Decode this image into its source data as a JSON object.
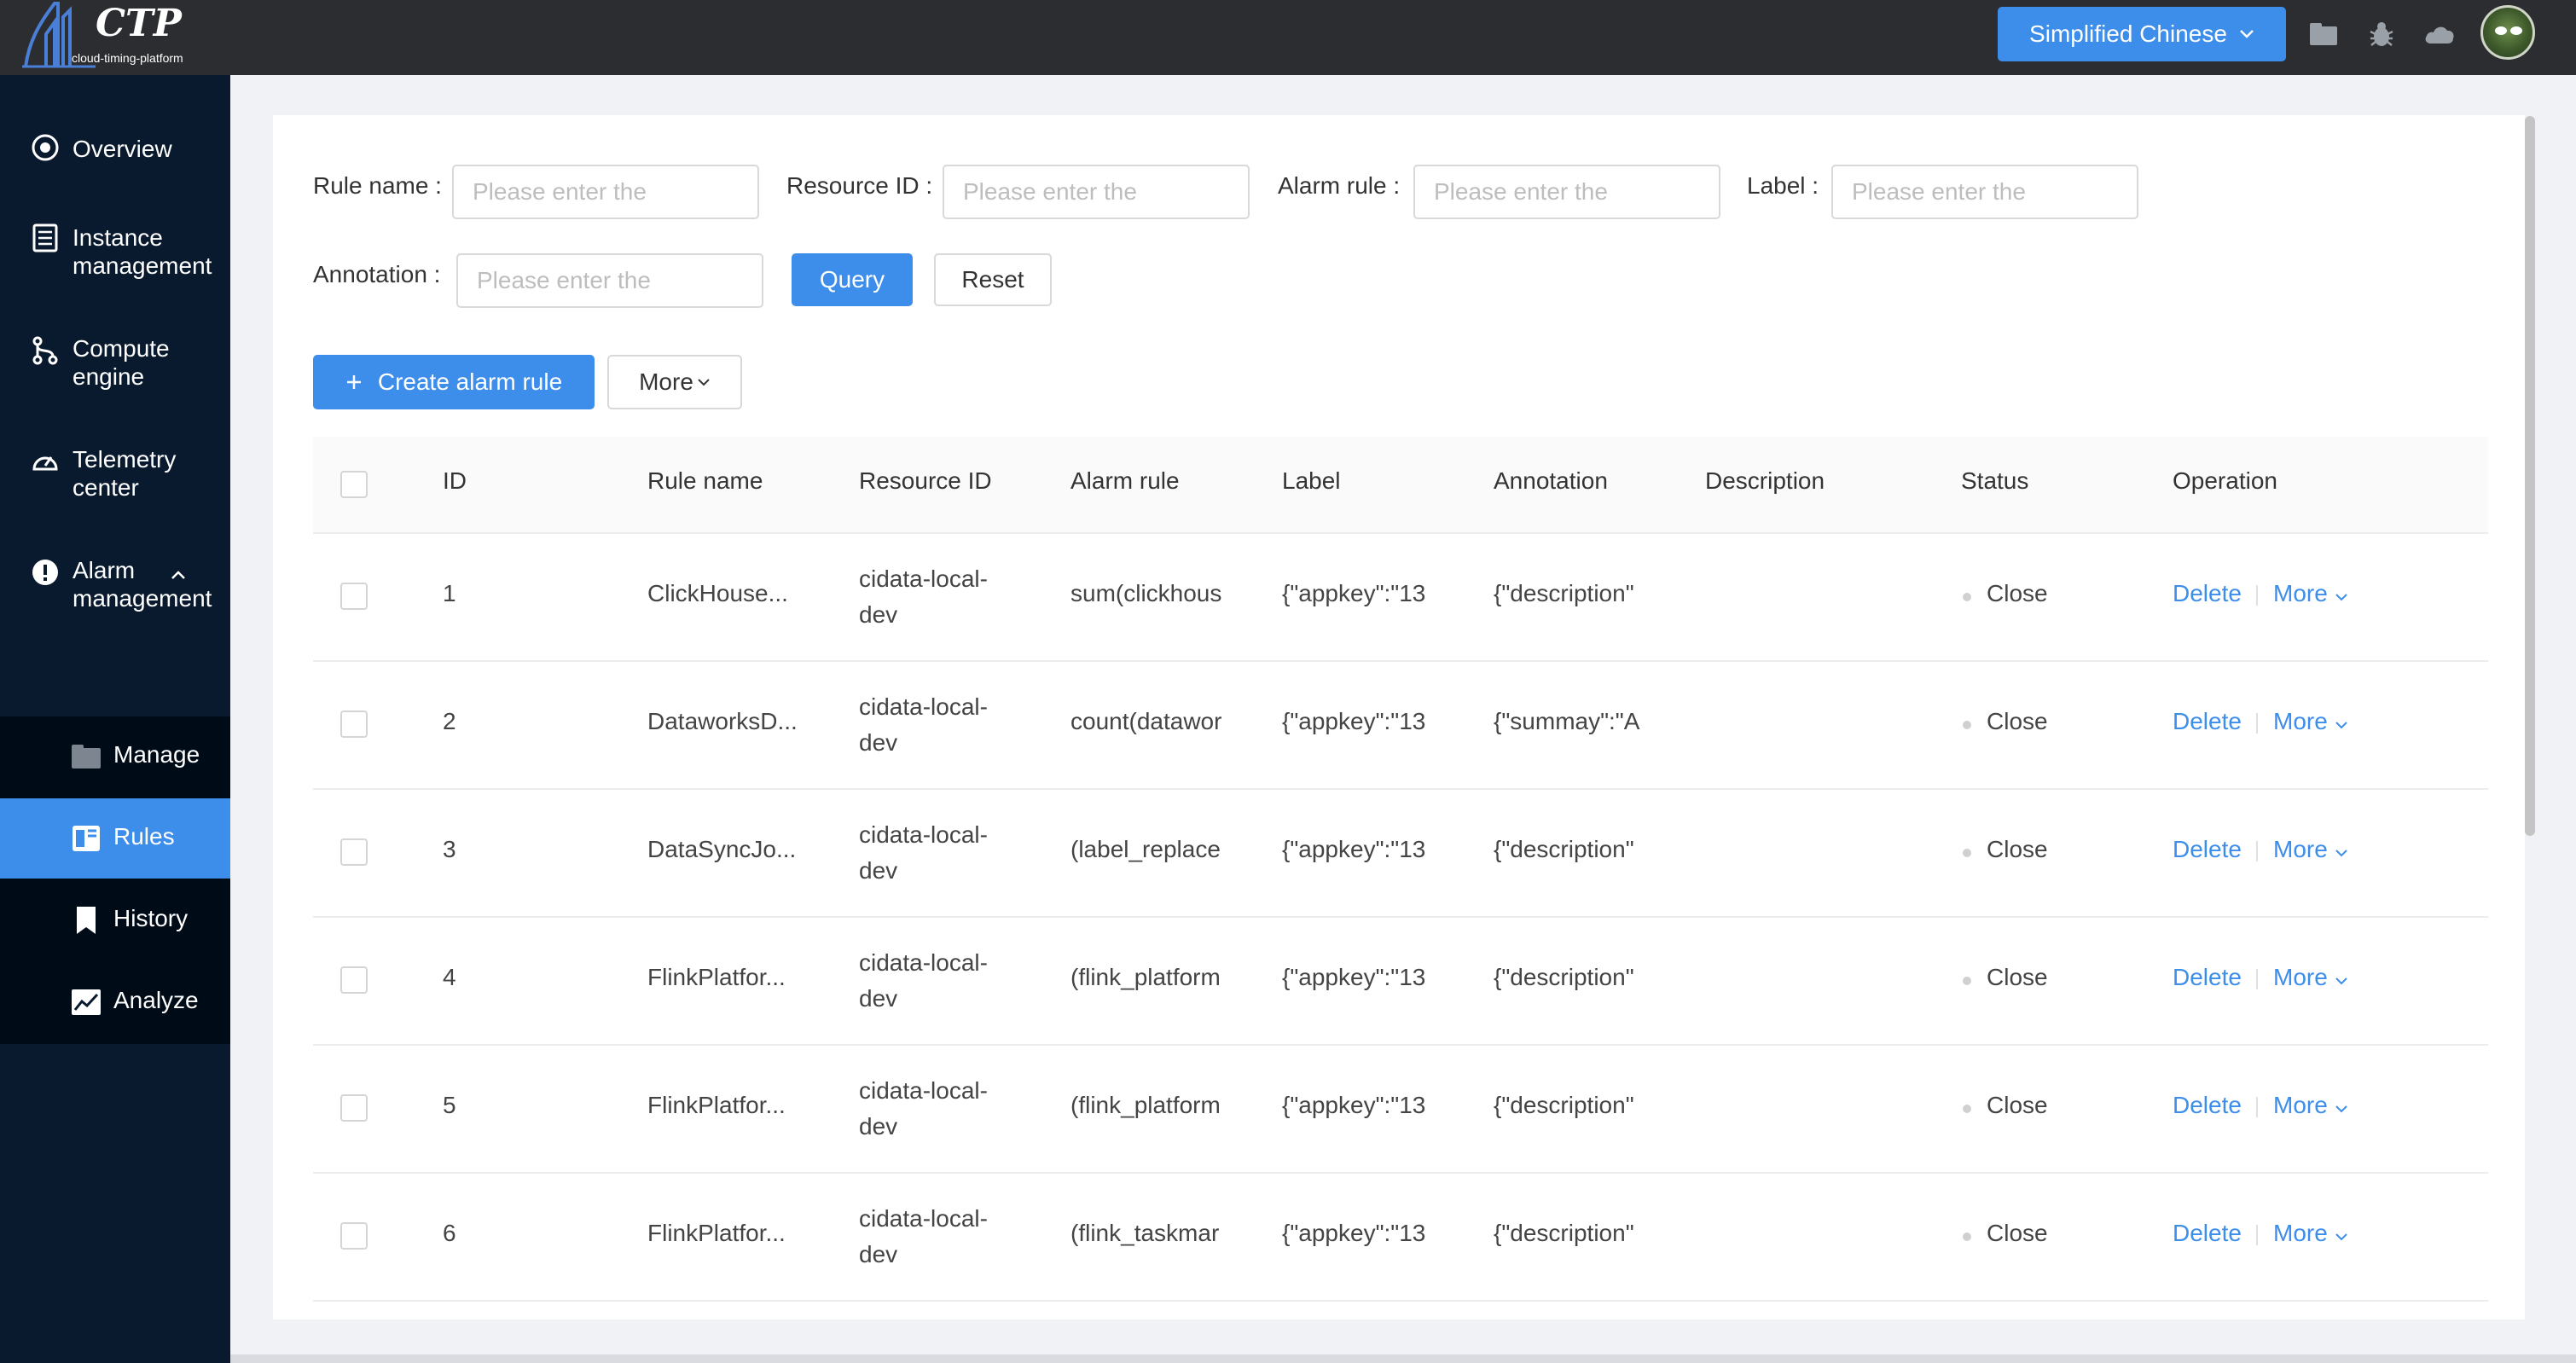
{
  "app": {
    "logo_title": "CTP",
    "logo_subtitle": "cloud-timing-platform"
  },
  "topbar": {
    "language": "Simplified Chinese"
  },
  "sidebar": {
    "items": [
      {
        "label": "Overview"
      },
      {
        "label": "Instance management"
      },
      {
        "label": "Compute engine"
      },
      {
        "label": "Telemetry center"
      },
      {
        "label": "Alarm management"
      }
    ],
    "submenu": [
      {
        "label": "Manage"
      },
      {
        "label": "Rules"
      },
      {
        "label": "History"
      },
      {
        "label": "Analyze"
      }
    ]
  },
  "filters": {
    "rule_name": {
      "label": "Rule name",
      "placeholder": "Please enter the"
    },
    "resource_id": {
      "label": "Resource ID",
      "placeholder": "Please enter the"
    },
    "alarm_rule": {
      "label": "Alarm rule",
      "placeholder": "Please enter the"
    },
    "label": {
      "label": "Label",
      "placeholder": "Please enter the"
    },
    "annotation": {
      "label": "Annotation",
      "placeholder": "Please enter the"
    },
    "query": "Query",
    "reset": "Reset"
  },
  "actions": {
    "create": "Create alarm rule",
    "more": "More"
  },
  "table": {
    "columns": [
      "ID",
      "Rule name",
      "Resource ID",
      "Alarm rule",
      "Label",
      "Annotation",
      "Description",
      "Status",
      "Operation"
    ],
    "rows": [
      {
        "id": "1",
        "rule_name": "ClickHouse...",
        "resource_l1": "cidata-local-",
        "resource_l2": "dev",
        "alarm_rule": "sum(clickhous",
        "label": "{\"appkey\":\"13",
        "annotation": "{\"description\"",
        "status": "Close",
        "delete": "Delete",
        "more": "More"
      },
      {
        "id": "2",
        "rule_name": "DataworksD...",
        "resource_l1": "cidata-local-",
        "resource_l2": "dev",
        "alarm_rule": "count(datawor",
        "label": "{\"appkey\":\"13",
        "annotation": "{\"summay\":\"A",
        "status": "Close",
        "delete": "Delete",
        "more": "More"
      },
      {
        "id": "3",
        "rule_name": "DataSyncJo...",
        "resource_l1": "cidata-local-",
        "resource_l2": "dev",
        "alarm_rule": "(label_replace",
        "label": "{\"appkey\":\"13",
        "annotation": "{\"description\"",
        "status": "Close",
        "delete": "Delete",
        "more": "More"
      },
      {
        "id": "4",
        "rule_name": "FlinkPlatfor...",
        "resource_l1": "cidata-local-",
        "resource_l2": "dev",
        "alarm_rule": "(flink_platform",
        "label": "{\"appkey\":\"13",
        "annotation": "{\"description\"",
        "status": "Close",
        "delete": "Delete",
        "more": "More"
      },
      {
        "id": "5",
        "rule_name": "FlinkPlatfor...",
        "resource_l1": "cidata-local-",
        "resource_l2": "dev",
        "alarm_rule": "(flink_platform",
        "label": "{\"appkey\":\"13",
        "annotation": "{\"description\"",
        "status": "Close",
        "delete": "Delete",
        "more": "More"
      },
      {
        "id": "6",
        "rule_name": "FlinkPlatfor...",
        "resource_l1": "cidata-local-",
        "resource_l2": "dev",
        "alarm_rule": "(flink_taskmar",
        "label": "{\"appkey\":\"13",
        "annotation": "{\"description\"",
        "status": "Close",
        "delete": "Delete",
        "more": "More"
      }
    ]
  },
  "colors": {
    "primary": "#3c8eea",
    "sidebar": "#0a1a2e",
    "topbar": "#2b2d30"
  }
}
